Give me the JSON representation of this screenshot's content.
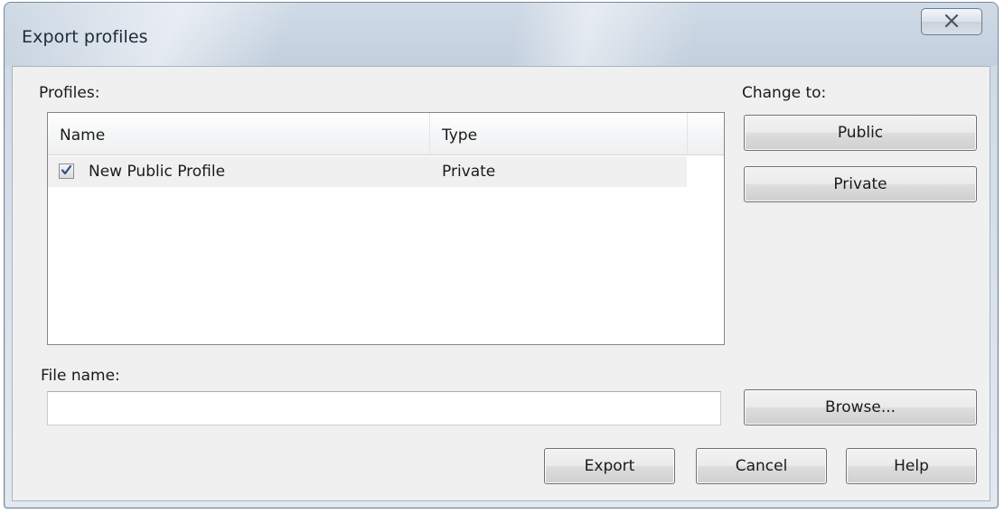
{
  "window": {
    "title": "Export profiles",
    "close_icon": "close-x-icon"
  },
  "profiles": {
    "label": "Profiles:",
    "columns": [
      "Name",
      "Type"
    ],
    "rows": [
      {
        "checked": true,
        "name": "New Public Profile",
        "type": "Private"
      }
    ]
  },
  "change_to": {
    "label": "Change to:",
    "public_label": "Public",
    "private_label": "Private"
  },
  "file": {
    "label": "File name:",
    "value": "",
    "browse_label": "Browse..."
  },
  "actions": {
    "export_label": "Export",
    "cancel_label": "Cancel",
    "help_label": "Help"
  }
}
